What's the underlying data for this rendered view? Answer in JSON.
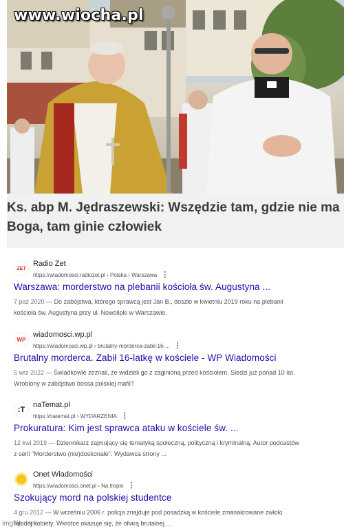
{
  "watermark": "www.wiocha.pl",
  "headline": "Ks. abp M. Jędraszewski: Wszędzie tam, gdzie nie ma Boga, tam ginie człowiek",
  "results": [
    {
      "source": "Radio Zet",
      "url": "https://wiadomosci.radiozet.pl › Polska › Warszawa",
      "title": "Warszawa: morderstwo na plebanii kościoła św. Augustyna ...",
      "date": "7 paź 2020",
      "snippet": "Do zabójstwa, którego sprawcą jest Jan B., doszło w kwietniu 2019 roku na plebanii kościoła św. Augustyna przy ul. Nowolipki w Warszawie.",
      "icon": "radio-zet-logo-icon",
      "favicon_text": "ZET",
      "favicon_bg": "#ffffff",
      "favicon_fg": "#d81f26"
    },
    {
      "source": "wiadomosci.wp.pl",
      "url": "https://wiadomosci.wp.pl › brutalny-morderca-zabil-16-...",
      "title": "Brutalny morderca. Zabił 16-latkę w kościele - WP Wiadomości",
      "date": "5 wrz 2022",
      "snippet": "Świadkowie zeznali, że widzieli go z zaginioną przed kościołem. Siedzi już ponad 10 lat. Wrobiony w zabójstwo bossa polskiej mafii?",
      "icon": "wp-logo-icon",
      "favicon_text": "WP",
      "favicon_bg": "#ffffff",
      "favicon_fg": "#e3262b"
    },
    {
      "source": "naTemat.pl",
      "url": "https://natemat.pl › WYDARZENIA",
      "title": "Prokuratura: Kim jest sprawca ataku w kościele św. ...",
      "date": "12 kwi 2019",
      "snippet": "Dziennikarz zajmujący się tematyką społeczną, polityczną i kryminalną. Autor podcastów z serii \"Morderstwo (nie)doskonałe\". Wydawca strony ...",
      "icon": "natemat-logo-icon",
      "favicon_text": ":T",
      "favicon_bg": "#ffffff",
      "favicon_fg": "#222222"
    },
    {
      "source": "Onet Wiadomości",
      "url": "https://wiadomosci.onet.pl › Na tropie",
      "title": "Szokujący mord na polskiej studentce",
      "date": "4 gru 2012",
      "snippet": "W wrześniu 2006 r. policja znajduje pod posadzką w kościele zmasakrowane zwłoki młodej kobiety. Wkrótce okazuje się, że ofiarą brutalnej ...",
      "icon": "onet-logo-icon",
      "favicon_text": "",
      "favicon_bg": "#f5c518",
      "favicon_fg": "#f5c518"
    }
  ],
  "date_separator": " — ",
  "kebab_glyph": "⋮",
  "footer": "imgflip.com",
  "colors": {
    "link": "#1a0dab",
    "snippet": "#4d5156",
    "headline": "#3a3a3a",
    "card_bg": "#f1f1f1"
  }
}
